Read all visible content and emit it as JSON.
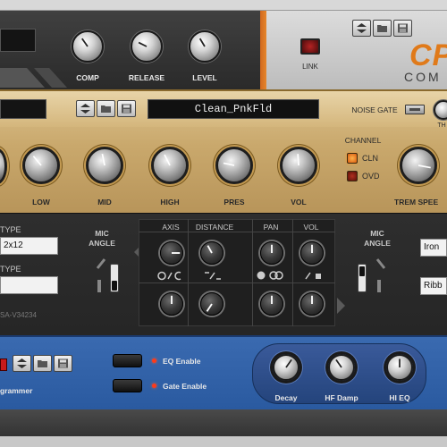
{
  "compressor": {
    "knobs": [
      {
        "label": "COMP"
      },
      {
        "label": "RELEASE"
      },
      {
        "label": "LEVEL"
      }
    ],
    "link_label": "LINK",
    "logo_text": "CP",
    "logo_sub": "COM"
  },
  "amp": {
    "preset_name": "Clean_PnkFld",
    "noise_gate_label": "NOISE GATE",
    "threshold_label": "TH",
    "channel_label": "CHANNEL",
    "channels": [
      "CLN",
      "OVD"
    ],
    "knobs": [
      {
        "label": "LOW"
      },
      {
        "label": "MID"
      },
      {
        "label": "HIGH"
      },
      {
        "label": "PRES"
      },
      {
        "label": "VOL"
      },
      {
        "label": "TREM SPEE"
      }
    ]
  },
  "cab": {
    "type_label_1": "TYPE",
    "type_value_1": "2x12",
    "type_label_2": "TYPE",
    "mic_angle_label_left": "MIC\nANGLE",
    "mic_angle_label_right": "MIC\nANGLE",
    "columns": [
      "AXIS",
      "DISTANCE",
      "PAN",
      "VOL"
    ],
    "right_box_1": "Iron",
    "right_box_2": "Ribb",
    "serial": "SA-V34234"
  },
  "reverb": {
    "programmer_label": "grammer",
    "eq_enable_label": "EQ Enable",
    "gate_enable_label": "Gate Enable",
    "knobs": [
      {
        "label": "Decay"
      },
      {
        "label": "HF Damp"
      },
      {
        "label": "HI EQ"
      }
    ]
  },
  "colors": {
    "accent_orange": "#e07a1a",
    "amp_gold": "#c9a86c",
    "reverb_blue": "#2a5aa0"
  }
}
